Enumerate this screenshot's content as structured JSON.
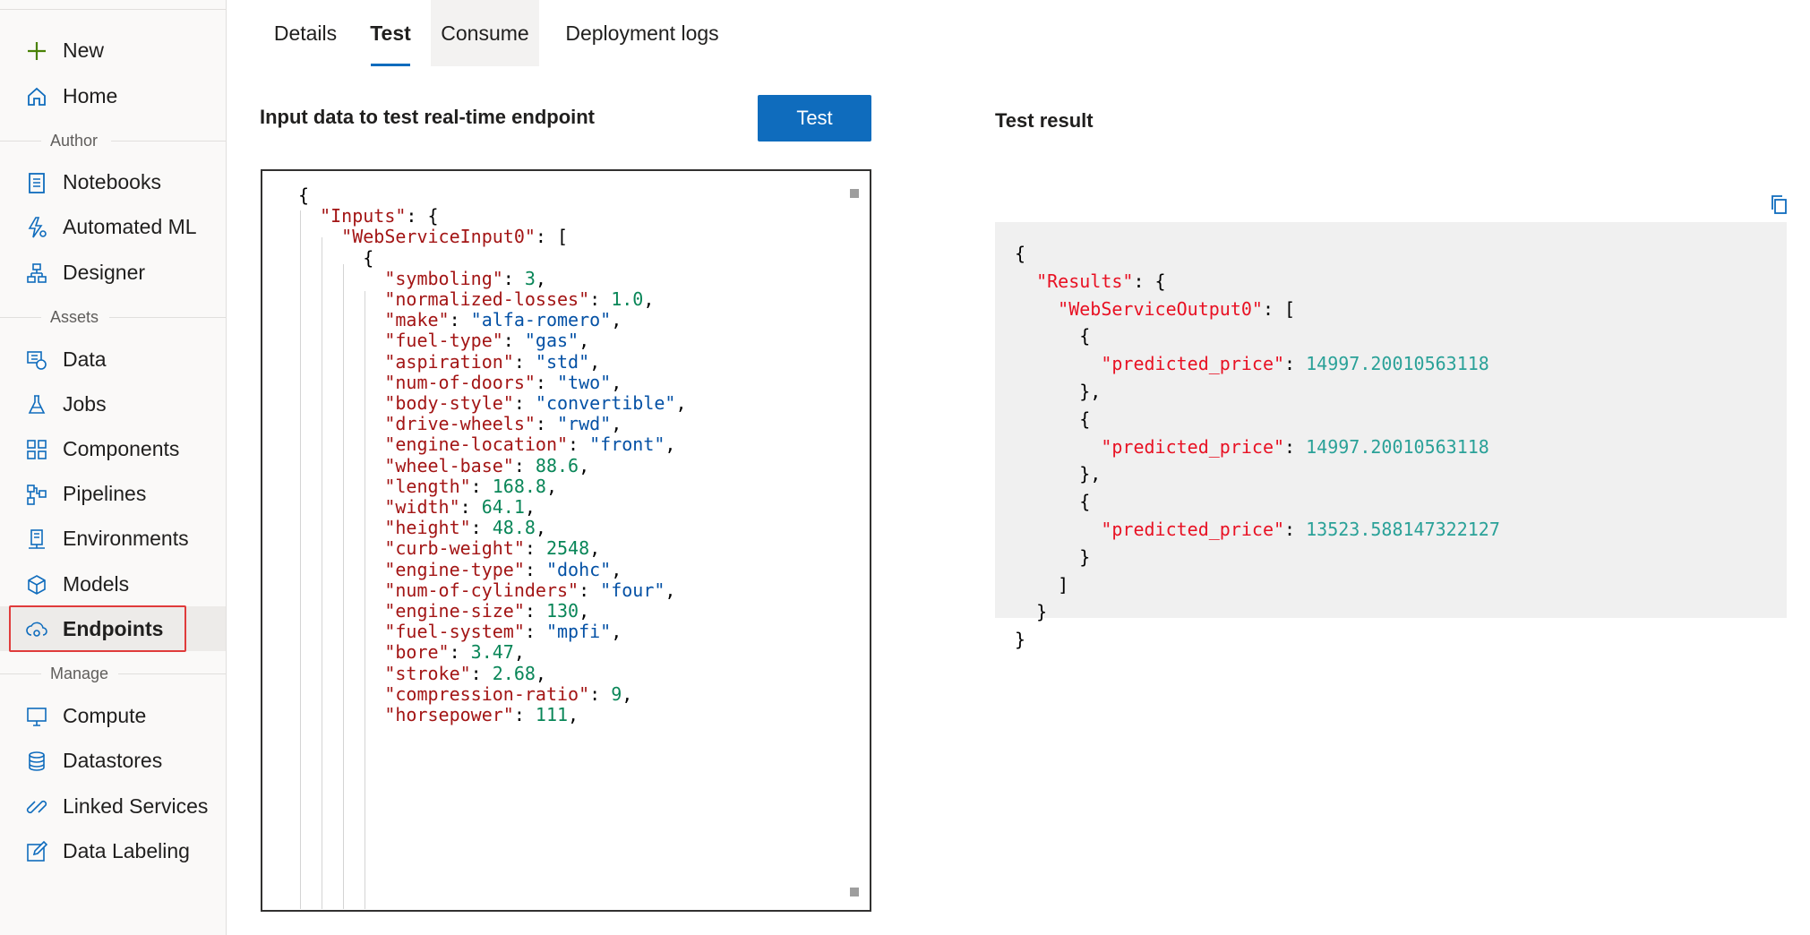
{
  "sidebar": {
    "items_top": [
      {
        "label": "New",
        "icon": "plus-icon"
      },
      {
        "label": "Home",
        "icon": "home-icon"
      }
    ],
    "sections": [
      {
        "title": "Author",
        "items": [
          {
            "label": "Notebooks",
            "icon": "notebook-icon"
          },
          {
            "label": "Automated ML",
            "icon": "automated-ml-icon"
          },
          {
            "label": "Designer",
            "icon": "designer-icon"
          }
        ]
      },
      {
        "title": "Assets",
        "items": [
          {
            "label": "Data",
            "icon": "data-icon"
          },
          {
            "label": "Jobs",
            "icon": "flask-icon"
          },
          {
            "label": "Components",
            "icon": "components-icon"
          },
          {
            "label": "Pipelines",
            "icon": "pipelines-icon"
          },
          {
            "label": "Environments",
            "icon": "environments-icon"
          },
          {
            "label": "Models",
            "icon": "cube-icon"
          },
          {
            "label": "Endpoints",
            "icon": "endpoints-icon",
            "active": true
          }
        ]
      },
      {
        "title": "Manage",
        "items": [
          {
            "label": "Compute",
            "icon": "monitor-icon"
          },
          {
            "label": "Datastores",
            "icon": "database-icon"
          },
          {
            "label": "Linked Services",
            "icon": "link-icon"
          },
          {
            "label": "Data Labeling",
            "icon": "edit-icon"
          }
        ]
      }
    ]
  },
  "tabs": [
    {
      "label": "Details"
    },
    {
      "label": "Test",
      "active": true
    },
    {
      "label": "Consume"
    },
    {
      "label": "Deployment logs"
    }
  ],
  "input": {
    "title": "Input data to test real-time endpoint",
    "button_label": "Test",
    "code": {
      "root_key": "Inputs",
      "input_key": "WebServiceInput0",
      "fields": [
        {
          "key": "symboling",
          "value": "3",
          "type": "number"
        },
        {
          "key": "normalized-losses",
          "value": "1.0",
          "type": "number"
        },
        {
          "key": "make",
          "value": "alfa-romero",
          "type": "string"
        },
        {
          "key": "fuel-type",
          "value": "gas",
          "type": "string"
        },
        {
          "key": "aspiration",
          "value": "std",
          "type": "string"
        },
        {
          "key": "num-of-doors",
          "value": "two",
          "type": "string"
        },
        {
          "key": "body-style",
          "value": "convertible",
          "type": "string"
        },
        {
          "key": "drive-wheels",
          "value": "rwd",
          "type": "string"
        },
        {
          "key": "engine-location",
          "value": "front",
          "type": "string"
        },
        {
          "key": "wheel-base",
          "value": "88.6",
          "type": "number"
        },
        {
          "key": "length",
          "value": "168.8",
          "type": "number"
        },
        {
          "key": "width",
          "value": "64.1",
          "type": "number"
        },
        {
          "key": "height",
          "value": "48.8",
          "type": "number"
        },
        {
          "key": "curb-weight",
          "value": "2548",
          "type": "number"
        },
        {
          "key": "engine-type",
          "value": "dohc",
          "type": "string"
        },
        {
          "key": "num-of-cylinders",
          "value": "four",
          "type": "string"
        },
        {
          "key": "engine-size",
          "value": "130",
          "type": "number"
        },
        {
          "key": "fuel-system",
          "value": "mpfi",
          "type": "string"
        },
        {
          "key": "bore",
          "value": "3.47",
          "type": "number"
        },
        {
          "key": "stroke",
          "value": "2.68",
          "type": "number"
        },
        {
          "key": "compression-ratio",
          "value": "9",
          "type": "number"
        },
        {
          "key": "horsepower",
          "value": "111",
          "type": "number"
        }
      ]
    }
  },
  "result": {
    "title": "Test result",
    "root_key": "Results",
    "output_key": "WebServiceOutput0",
    "predictions": [
      {
        "key": "predicted_price",
        "value": "14997.20010563118"
      },
      {
        "key": "predicted_price",
        "value": "14997.20010563118"
      },
      {
        "key": "predicted_price",
        "value": "13523.588147322127"
      }
    ]
  }
}
